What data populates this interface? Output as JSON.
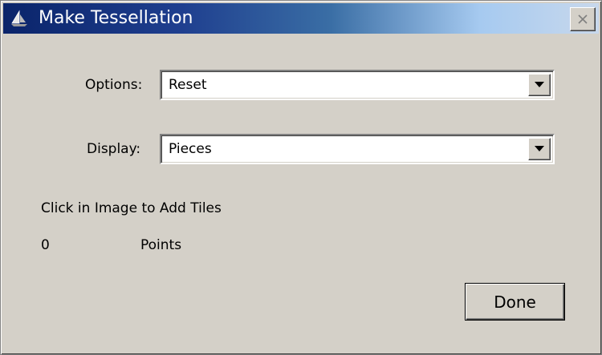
{
  "window": {
    "title": "Make Tessellation",
    "icon": "app-icon",
    "close_icon": "close-icon"
  },
  "form": {
    "options_label": "Options:",
    "options_value": "Reset",
    "display_label": "Display:",
    "display_value": "Pieces"
  },
  "status": {
    "instruction": "Click in Image to Add Tiles",
    "points_count": "0",
    "points_label": "Points"
  },
  "buttons": {
    "done_label": "Done"
  },
  "colors": {
    "face": "#d4d0c8",
    "titlebar_start": "#0a246a",
    "titlebar_end": "#c8d8ec"
  }
}
